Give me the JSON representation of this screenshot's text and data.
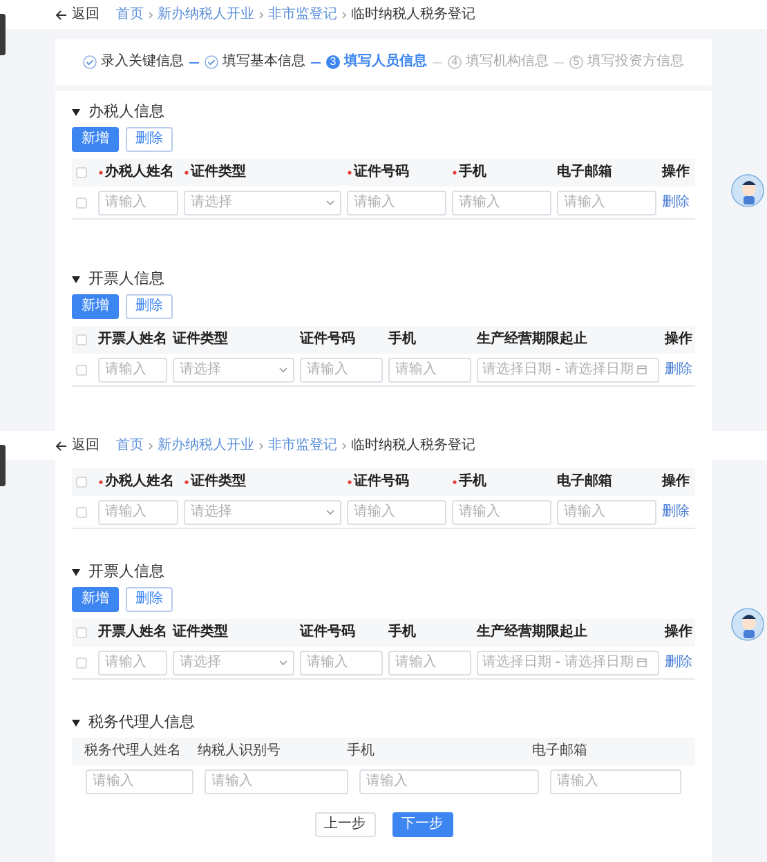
{
  "panes": [
    {
      "back_label": "返回",
      "breadcrumb": [
        {
          "label": "首页",
          "link": true
        },
        {
          "label": "新办纳税人开业",
          "link": true
        },
        {
          "label": "非市监登记",
          "link": true
        },
        {
          "label": "临时纳税人税务登记",
          "link": false
        }
      ],
      "steps": [
        {
          "label": "录入关键信息",
          "done": true,
          "active": false
        },
        {
          "label": "填写基本信息",
          "done": true,
          "active": false
        },
        {
          "number": "3",
          "label": "填写人员信息",
          "done": false,
          "active": true
        },
        {
          "number": "4",
          "label": "填写机构信息",
          "done": false,
          "active": false
        },
        {
          "number": "5",
          "label": "填写投资方信息",
          "done": false,
          "active": false
        }
      ],
      "sections": [
        {
          "kind": "handler",
          "title": "办税人信息",
          "buttons": [
            {
              "label": "新增",
              "primary": true
            },
            {
              "label": "删除",
              "primary": false
            }
          ],
          "all_checked": false,
          "columns": [
            {
              "label": "办税人姓名",
              "required": true
            },
            {
              "label": "证件类型",
              "required": true
            },
            {
              "label": "证件号码",
              "required": true
            },
            {
              "label": "手机",
              "required": true
            },
            {
              "label": "电子邮箱",
              "required": false
            },
            {
              "label": "操作",
              "required": false
            }
          ],
          "row": {
            "checked": false,
            "cells": [
              {
                "kind": "input",
                "placeholder": "请输入"
              },
              {
                "kind": "select",
                "placeholder": "请选择"
              },
              {
                "kind": "input",
                "placeholder": "请输入"
              },
              {
                "kind": "input",
                "placeholder": "请输入"
              },
              {
                "kind": "input",
                "placeholder": "请输入"
              },
              {
                "kind": "link",
                "label": "删除"
              }
            ]
          }
        },
        {
          "kind": "invoicer",
          "title": "开票人信息",
          "buttons": [
            {
              "label": "新增",
              "primary": true
            },
            {
              "label": "删除",
              "primary": false
            }
          ],
          "all_checked": false,
          "columns": [
            {
              "label": "开票人姓名",
              "required": false
            },
            {
              "label": "证件类型",
              "required": false
            },
            {
              "label": "证件号码",
              "required": false
            },
            {
              "label": "手机",
              "required": false
            },
            {
              "label": "生产经营期限起止",
              "required": false
            },
            {
              "label": "操作",
              "required": false
            }
          ],
          "row": {
            "checked": false,
            "cells": [
              {
                "kind": "input",
                "placeholder": "请输入"
              },
              {
                "kind": "select",
                "placeholder": "请选择"
              },
              {
                "kind": "input",
                "placeholder": "请输入"
              },
              {
                "kind": "input",
                "placeholder": "请输入"
              },
              {
                "kind": "daterange",
                "start": "请选择日期",
                "separator": "-",
                "end": "请选择日期"
              },
              {
                "kind": "link",
                "label": "删除"
              }
            ]
          }
        }
      ]
    },
    {
      "back_label": "返回",
      "breadcrumb": [
        {
          "label": "首页",
          "link": true
        },
        {
          "label": "新办纳税人开业",
          "link": true
        },
        {
          "label": "非市监登记",
          "link": true
        },
        {
          "label": "临时纳税人税务登记",
          "link": false
        }
      ],
      "sections": [
        {
          "kind": "handler",
          "all_checked": false,
          "columns": [
            {
              "label": "办税人姓名",
              "required": true
            },
            {
              "label": "证件类型",
              "required": true
            },
            {
              "label": "证件号码",
              "required": true
            },
            {
              "label": "手机",
              "required": true
            },
            {
              "label": "电子邮箱",
              "required": false
            },
            {
              "label": "操作",
              "required": false
            }
          ],
          "row": {
            "checked": false,
            "cells": [
              {
                "kind": "input",
                "placeholder": "请输入"
              },
              {
                "kind": "select",
                "placeholder": "请选择"
              },
              {
                "kind": "input",
                "placeholder": "请输入"
              },
              {
                "kind": "input",
                "placeholder": "请输入"
              },
              {
                "kind": "input",
                "placeholder": "请输入"
              },
              {
                "kind": "link",
                "label": "删除"
              }
            ]
          }
        },
        {
          "kind": "invoicer",
          "title": "开票人信息",
          "buttons": [
            {
              "label": "新增",
              "primary": true
            },
            {
              "label": "删除",
              "primary": false
            }
          ],
          "all_checked": false,
          "columns": [
            {
              "label": "开票人姓名",
              "required": false
            },
            {
              "label": "证件类型",
              "required": false
            },
            {
              "label": "证件号码",
              "required": false
            },
            {
              "label": "手机",
              "required": false
            },
            {
              "label": "生产经营期限起止",
              "required": false
            },
            {
              "label": "操作",
              "required": false
            }
          ],
          "row": {
            "checked": false,
            "cells": [
              {
                "kind": "input",
                "placeholder": "请输入"
              },
              {
                "kind": "select",
                "placeholder": "请选择"
              },
              {
                "kind": "input",
                "placeholder": "请输入"
              },
              {
                "kind": "input",
                "placeholder": "请输入"
              },
              {
                "kind": "daterange",
                "start": "请选择日期",
                "separator": "-",
                "end": "请选择日期"
              },
              {
                "kind": "link",
                "label": "删除"
              }
            ]
          }
        },
        {
          "kind": "agent",
          "title": "税务代理人信息",
          "columns": [
            {
              "label": "税务代理人姓名",
              "required": false
            },
            {
              "label": "纳税人识别号",
              "required": false
            },
            {
              "label": "手机",
              "required": false
            },
            {
              "label": "电子邮箱",
              "required": false
            }
          ],
          "row": {
            "cells": [
              {
                "kind": "input",
                "placeholder": "请输入"
              },
              {
                "kind": "input",
                "placeholder": "请输入"
              },
              {
                "kind": "input",
                "placeholder": "请输入"
              },
              {
                "kind": "input",
                "placeholder": "请输入"
              }
            ]
          }
        }
      ],
      "footer_buttons": [
        {
          "label": "上一步",
          "primary": false
        },
        {
          "label": "下一步",
          "primary": true
        }
      ]
    }
  ]
}
